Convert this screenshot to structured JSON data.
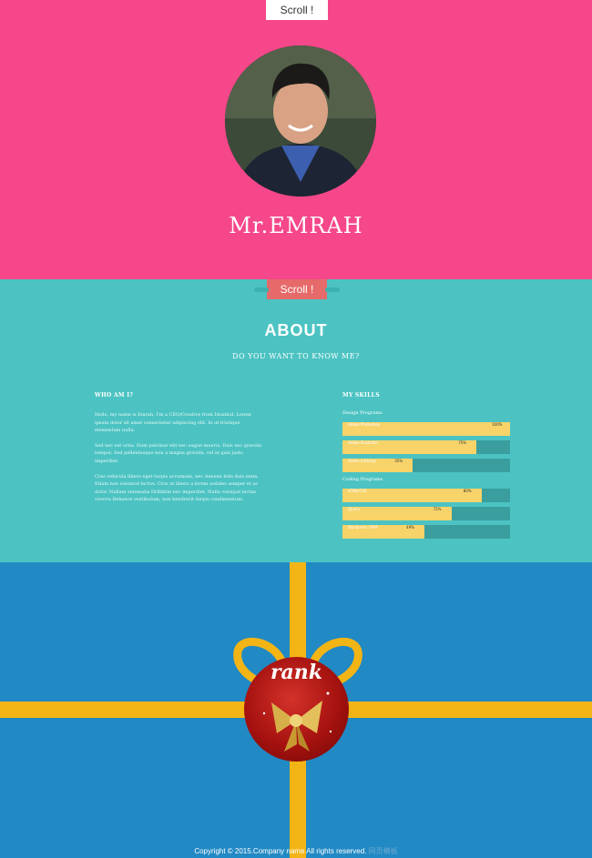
{
  "hero": {
    "scroll_label": "Scroll !",
    "name": "Mr.EMRAH"
  },
  "about": {
    "scroll_label": "Scroll !",
    "title": "ABOUT",
    "subtitle": "DO YOU WANT TO KNOW ME?",
    "who_title": "WHO AM I?",
    "paragraphs": [
      "Hello, my name is Emrah, I'm a CEO/Creative from Istanbul. Lorem ipsum dolor sit amet consectetur adipiscing elit. In ut-tristique elementum nulla.",
      "Sed nec est urna. Nam pulvinar elit nec augue mauris. Duis nec gravida tempor. Sed pellentesque non a magna gravida, vel at quis justo imperdiet.",
      "Cras vehicula libero eget turpis accumsan, nec Aenean felis duis enim. Etiam non euismod lectus. Cras at libero a lorem sodales semper et ac dolor. Nullam venenatis Dribbble nec imperdiet. Nulla volutpat lectus viverra Behance vestibulum, non hendrerit turpis condimentum."
    ],
    "skills_title": "MY SKILLS",
    "design_title": "Design Programs",
    "design": [
      {
        "label": "Adobe Photoshop",
        "pct": "100%",
        "value": 1.0
      },
      {
        "label": "Adobe Illustrator",
        "pct": "75%",
        "value": 0.8
      },
      {
        "label": "Adobe InDesign",
        "pct": "35%",
        "value": 0.42
      }
    ],
    "coding_title": "Coding Programs",
    "coding": [
      {
        "label": "HTML/CSS",
        "pct": "80%",
        "value": 0.83
      },
      {
        "label": "jQuery",
        "pct": "72%",
        "value": 0.65
      },
      {
        "label": "Wordpress / PHP",
        "pct": "49%",
        "value": 0.49
      }
    ]
  },
  "gift": {
    "seal_text": "rank",
    "footer_text": "Copyright © 2015.Company name All rights reserved.",
    "footer_dim": "网页模板"
  },
  "colors": {
    "hero_bg": "#f5478a",
    "about_bg": "#4cc3c2",
    "gift_bg": "#2189c4",
    "ribbon": "#f3b516",
    "bar_fill": "#f7d36a"
  }
}
